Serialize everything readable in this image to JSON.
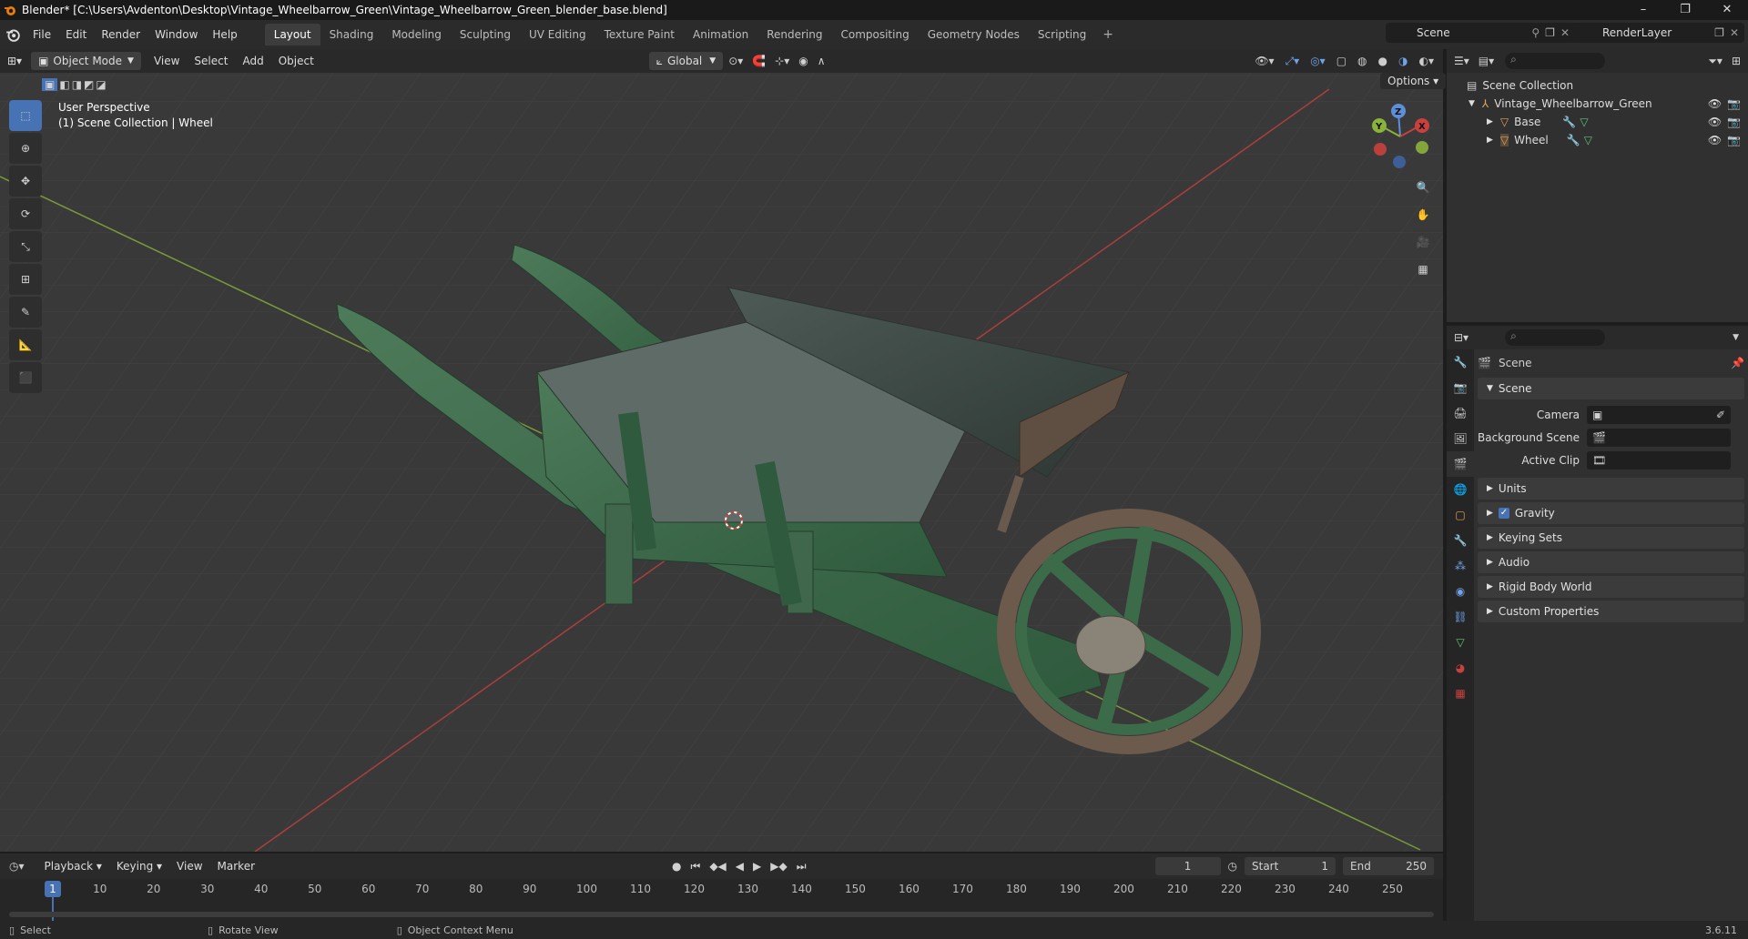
{
  "window": {
    "title": "Blender* [C:\\Users\\Avdenton\\Desktop\\Vintage_Wheelbarrow_Green\\Vintage_Wheelbarrow_Green_blender_base.blend]",
    "controls": [
      "–",
      "❐",
      "✕"
    ]
  },
  "menubar": {
    "menus": [
      "File",
      "Edit",
      "Render",
      "Window",
      "Help"
    ],
    "workspaces": [
      "Layout",
      "Shading",
      "Modeling",
      "Sculpting",
      "UV Editing",
      "Texture Paint",
      "Animation",
      "Rendering",
      "Compositing",
      "Geometry Nodes",
      "Scripting"
    ],
    "active_workspace": "Layout",
    "add": "+",
    "scene": "Scene",
    "render_layer": "RenderLayer"
  },
  "viewport": {
    "mode": "Object Mode",
    "menus": [
      "View",
      "Select",
      "Add",
      "Object"
    ],
    "orientation": "Global",
    "options": "Options",
    "info_line1": "User Perspective",
    "info_line2": "(1) Scene Collection | Wheel",
    "gizmo": {
      "z": "Z",
      "y": "Y",
      "x": "X"
    }
  },
  "outliner": {
    "root": "Scene Collection",
    "items": [
      {
        "label": "Vintage_Wheelbarrow_Green"
      },
      {
        "label": "Base"
      },
      {
        "label": "Wheel"
      }
    ]
  },
  "properties": {
    "context": "Scene",
    "section": "Scene",
    "fields": [
      {
        "label": "Camera"
      },
      {
        "label": "Background Scene"
      },
      {
        "label": "Active Clip"
      }
    ],
    "panels": [
      "Units",
      "Gravity",
      "Keying Sets",
      "Audio",
      "Rigid Body World",
      "Custom Properties"
    ]
  },
  "timeline": {
    "menus": [
      "Playback",
      "Keying",
      "View",
      "Marker"
    ],
    "current_frame": "1",
    "start_label": "Start",
    "start": "1",
    "end_label": "End",
    "end": "250",
    "ticks": [
      "1",
      "10",
      "20",
      "30",
      "40",
      "50",
      "60",
      "70",
      "80",
      "90",
      "100",
      "110",
      "120",
      "130",
      "140",
      "150",
      "160",
      "170",
      "180",
      "190",
      "200",
      "210",
      "220",
      "230",
      "240",
      "250"
    ]
  },
  "status": {
    "select": "Select",
    "rotate": "Rotate View",
    "context_menu": "Object Context Menu",
    "version": "3.6.11"
  },
  "colors": {
    "accent": "#4772b3",
    "x_axis": "#c8413e",
    "y_axis": "#8bb33a",
    "wheelbarrow_green": "#3c6b4a"
  }
}
